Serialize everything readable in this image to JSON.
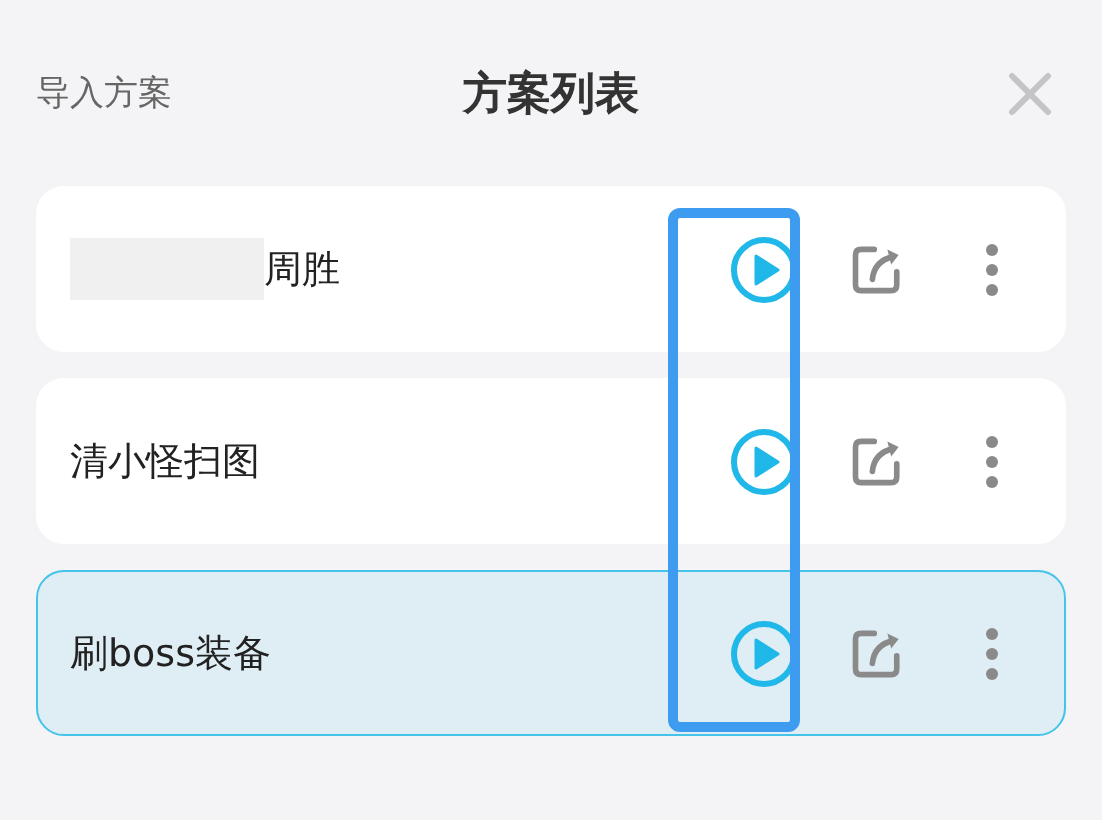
{
  "header": {
    "import_link": "导入方案",
    "title": "方案列表"
  },
  "plans": [
    {
      "name": "周胜",
      "redacted": true,
      "selected": false
    },
    {
      "name": "清小怪扫图",
      "redacted": false,
      "selected": false
    },
    {
      "name": "刷boss装备",
      "redacted": false,
      "selected": true
    }
  ],
  "highlight": {
    "on": true
  }
}
